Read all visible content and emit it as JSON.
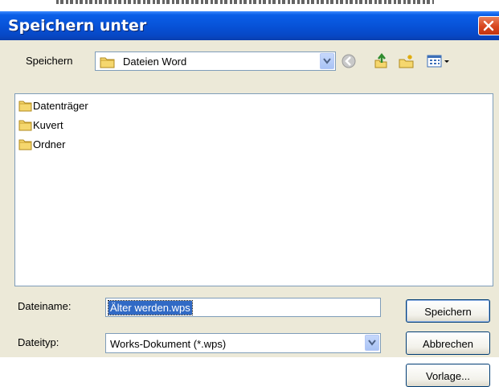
{
  "dialog": {
    "title": "Speichern unter",
    "close_icon": "close-icon"
  },
  "look_in": {
    "label": "Speichern",
    "value": "Dateien Word"
  },
  "toolbar": {
    "back_icon": "back-icon",
    "up_icon": "up-folder-icon",
    "new_folder_icon": "new-folder-icon",
    "views_icon": "views-menu-icon"
  },
  "files": [
    {
      "name": "Datenträger",
      "icon": "folder-icon"
    },
    {
      "name": "Kuvert",
      "icon": "folder-icon"
    },
    {
      "name": "Ordner",
      "icon": "folder-icon"
    }
  ],
  "filename": {
    "label": "Dateiname:",
    "value": "Älter werden.wps"
  },
  "filetype": {
    "label": "Dateityp:",
    "value": "Works-Dokument (*.wps)"
  },
  "buttons": {
    "save": "Speichern",
    "cancel": "Abbrechen",
    "template": "Vorlage..."
  },
  "colors": {
    "title_bar": "#0751d6",
    "selection": "#316ac5",
    "dialog_bg": "#ece9d8",
    "close": "#d8461e"
  }
}
